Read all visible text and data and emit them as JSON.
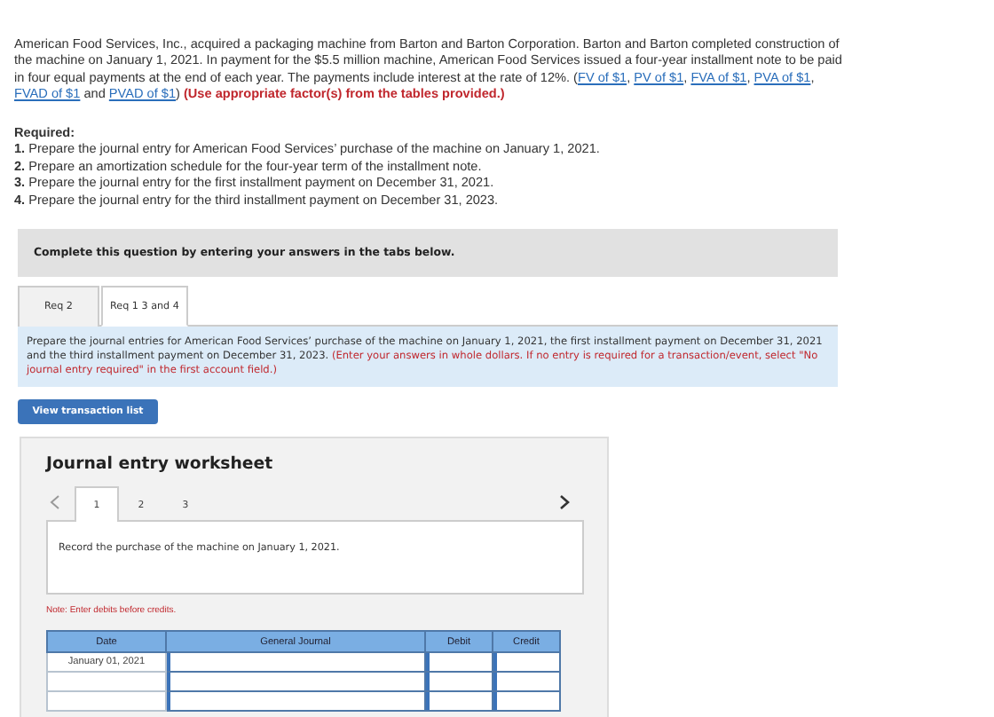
{
  "problem": {
    "parts": [
      {
        "kind": "text",
        "text": "American Food Services, Inc., acquired a packaging machine from Barton and Barton Corporation. Barton and Barton completed construction of the machine on January 1, 2021. In payment for the $5.5 million machine, American Food Services issued a four-year installment note to be paid in four equal payments at the end of each year. The payments include interest at the rate of 12%. ("
      },
      {
        "kind": "link",
        "text": "FV of $1"
      },
      {
        "kind": "text",
        "text": ", "
      },
      {
        "kind": "link",
        "text": "PV of $1"
      },
      {
        "kind": "text",
        "text": ", "
      },
      {
        "kind": "link",
        "text": "FVA of $1"
      },
      {
        "kind": "text",
        "text": ", "
      },
      {
        "kind": "link",
        "text": "PVA of $1"
      },
      {
        "kind": "text",
        "text": ", "
      },
      {
        "kind": "link",
        "text": "FVAD of $1"
      },
      {
        "kind": "text",
        "text": " and "
      },
      {
        "kind": "link",
        "text": "PVAD of $1"
      },
      {
        "kind": "text",
        "text": ") "
      },
      {
        "kind": "warning",
        "text": "(Use appropriate factor(s) from the tables provided.)"
      }
    ]
  },
  "required": {
    "heading": "Required:",
    "items": [
      "**1.** Prepare the journal entry for American Food Services’ purchase of the machine on January 1, 2021.",
      "**2.** Prepare an amortization schedule for the four-year term of the installment note.",
      "**3.** Prepare the journal entry for the first installment payment on December 31, 2021.",
      "**4.** Prepare the journal entry for the third installment payment on December 31, 2023."
    ]
  },
  "banner": "Complete this question by entering your answers in the tabs below.",
  "tabs": [
    {
      "label": "Req 2",
      "selected": false
    },
    {
      "label": "Req 1 3 and 4",
      "selected": true
    }
  ],
  "instructions": {
    "text": "Prepare the journal entries for American Food Services’ purchase of the machine on January 1, 2021, the first installment payment on December 31, 2021 and the third installment payment on December 31, 2023.",
    "note": "(Enter your answers in whole dollars. If no entry is required for a transaction/event, select \"No journal entry required\" in the first account field.)"
  },
  "view_button": "View transaction list",
  "worksheet": {
    "title": "Journal entry worksheet",
    "pages": [
      {
        "label": "1",
        "selected": true
      },
      {
        "label": "2",
        "selected": false
      },
      {
        "label": "3",
        "selected": false
      }
    ],
    "description": "Record the purchase of the machine on January 1, 2021.",
    "note": "Note: Enter debits before credits.",
    "columns": [
      "Date",
      "General Journal",
      "Debit",
      "Credit"
    ],
    "rows": [
      {
        "kind": "entry",
        "date": "January 01, 2021"
      },
      {
        "kind": "blank"
      },
      {
        "kind": "blank"
      }
    ]
  }
}
